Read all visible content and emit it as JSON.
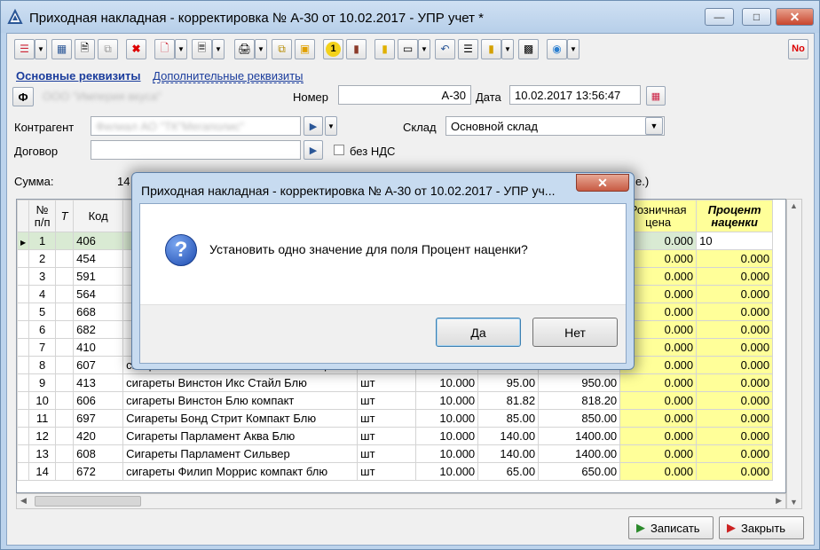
{
  "window": {
    "title": "Приходная накладная - корректировка № А-30 от 10.02.2017 - УПР учет *"
  },
  "tabs": {
    "main": "Основные реквизиты",
    "extra": "Дополнительные реквизиты"
  },
  "form": {
    "org_button": "Ф",
    "org_value": "ООО \"Империя вкуса\"",
    "number_label": "Номер",
    "number_value": "А-30",
    "date_label": "Дата",
    "date_value": "10.02.2017 13:56:47",
    "contractor_label": "Контрагент",
    "contractor_value": "Филиал АО \"ТК\"Мегаполис\"",
    "warehouse_label": "Склад",
    "warehouse_value": "Основной склад",
    "contract_label": "Договор",
    "contract_value": "",
    "no_vat_label": "без НДС",
    "sum_label": "Сумма:",
    "sum_partial": "14",
    "sum_suffix": "е.)"
  },
  "toolbar": {
    "right_button": "No"
  },
  "table": {
    "headers": {
      "num": "№ п/п",
      "t": "Т",
      "code": "Код",
      "retail": "Розничная цена",
      "markup": "Процент наценки"
    },
    "rows": [
      {
        "n": "1",
        "code": "406",
        "name": "",
        "unit": "",
        "qty": "",
        "price": "",
        "sum": "",
        "retail": "0.000",
        "markup": "10"
      },
      {
        "n": "2",
        "code": "454",
        "name": "",
        "unit": "",
        "qty": "",
        "price": "",
        "sum": "",
        "retail": "0.000",
        "markup": "0.000"
      },
      {
        "n": "3",
        "code": "591",
        "name": "",
        "unit": "",
        "qty": "",
        "price": "",
        "sum": "",
        "retail": "0.000",
        "markup": "0.000"
      },
      {
        "n": "4",
        "code": "564",
        "name": "",
        "unit": "",
        "qty": "",
        "price": "",
        "sum": "",
        "retail": "0.000",
        "markup": "0.000"
      },
      {
        "n": "5",
        "code": "668",
        "name": "",
        "unit": "",
        "qty": "",
        "price": "",
        "sum": "",
        "retail": "0.000",
        "markup": "0.000"
      },
      {
        "n": "6",
        "code": "682",
        "name": "",
        "unit": "",
        "qty": "",
        "price": "",
        "sum": "",
        "retail": "0.000",
        "markup": "0.000"
      },
      {
        "n": "7",
        "code": "410",
        "name": "",
        "unit": "",
        "qty": "",
        "price": "",
        "sum": "",
        "retail": "0.000",
        "markup": "0.000"
      },
      {
        "n": "8",
        "code": "607",
        "name": "сигареты Винстон Икс Стайл Сильвер",
        "unit": "шт",
        "qty": "",
        "price": "",
        "sum": "",
        "retail": "0.000",
        "markup": "0.000"
      },
      {
        "n": "9",
        "code": "413",
        "name": "сигареты Винстон Икс Стайл Блю",
        "unit": "шт",
        "qty": "10.000",
        "price": "95.00",
        "sum": "950.00",
        "retail": "0.000",
        "markup": "0.000"
      },
      {
        "n": "10",
        "code": "606",
        "name": "сигареты Винстон Блю компакт",
        "unit": "шт",
        "qty": "10.000",
        "price": "81.82",
        "sum": "818.20",
        "retail": "0.000",
        "markup": "0.000"
      },
      {
        "n": "11",
        "code": "697",
        "name": "Сигареты Бонд Стрит Компакт Блю",
        "unit": "шт",
        "qty": "10.000",
        "price": "85.00",
        "sum": "850.00",
        "retail": "0.000",
        "markup": "0.000"
      },
      {
        "n": "12",
        "code": "420",
        "name": "Сигареты Парламент Аква Блю",
        "unit": "шт",
        "qty": "10.000",
        "price": "140.00",
        "sum": "1400.00",
        "retail": "0.000",
        "markup": "0.000"
      },
      {
        "n": "13",
        "code": "608",
        "name": "Сигареты Парламент Сильвер",
        "unit": "шт",
        "qty": "10.000",
        "price": "140.00",
        "sum": "1400.00",
        "retail": "0.000",
        "markup": "0.000"
      },
      {
        "n": "14",
        "code": "672",
        "name": "сигареты Филип Моррис  компакт блю",
        "unit": "шт",
        "qty": "10.000",
        "price": "65.00",
        "sum": "650.00",
        "retail": "0.000",
        "markup": "0.000"
      }
    ]
  },
  "buttons": {
    "save": "Записать",
    "close": "Закрыть"
  },
  "dialog": {
    "title": "Приходная накладная - корректировка № А-30 от 10.02.2017 - УПР уч...",
    "message": "Установить одно значение для поля Процент наценки?",
    "yes": "Да",
    "no": "Нет"
  },
  "colors": {
    "highlight_column": "#ffff99",
    "selected_row": "#d9ead3",
    "link": "#1a3c9c"
  }
}
